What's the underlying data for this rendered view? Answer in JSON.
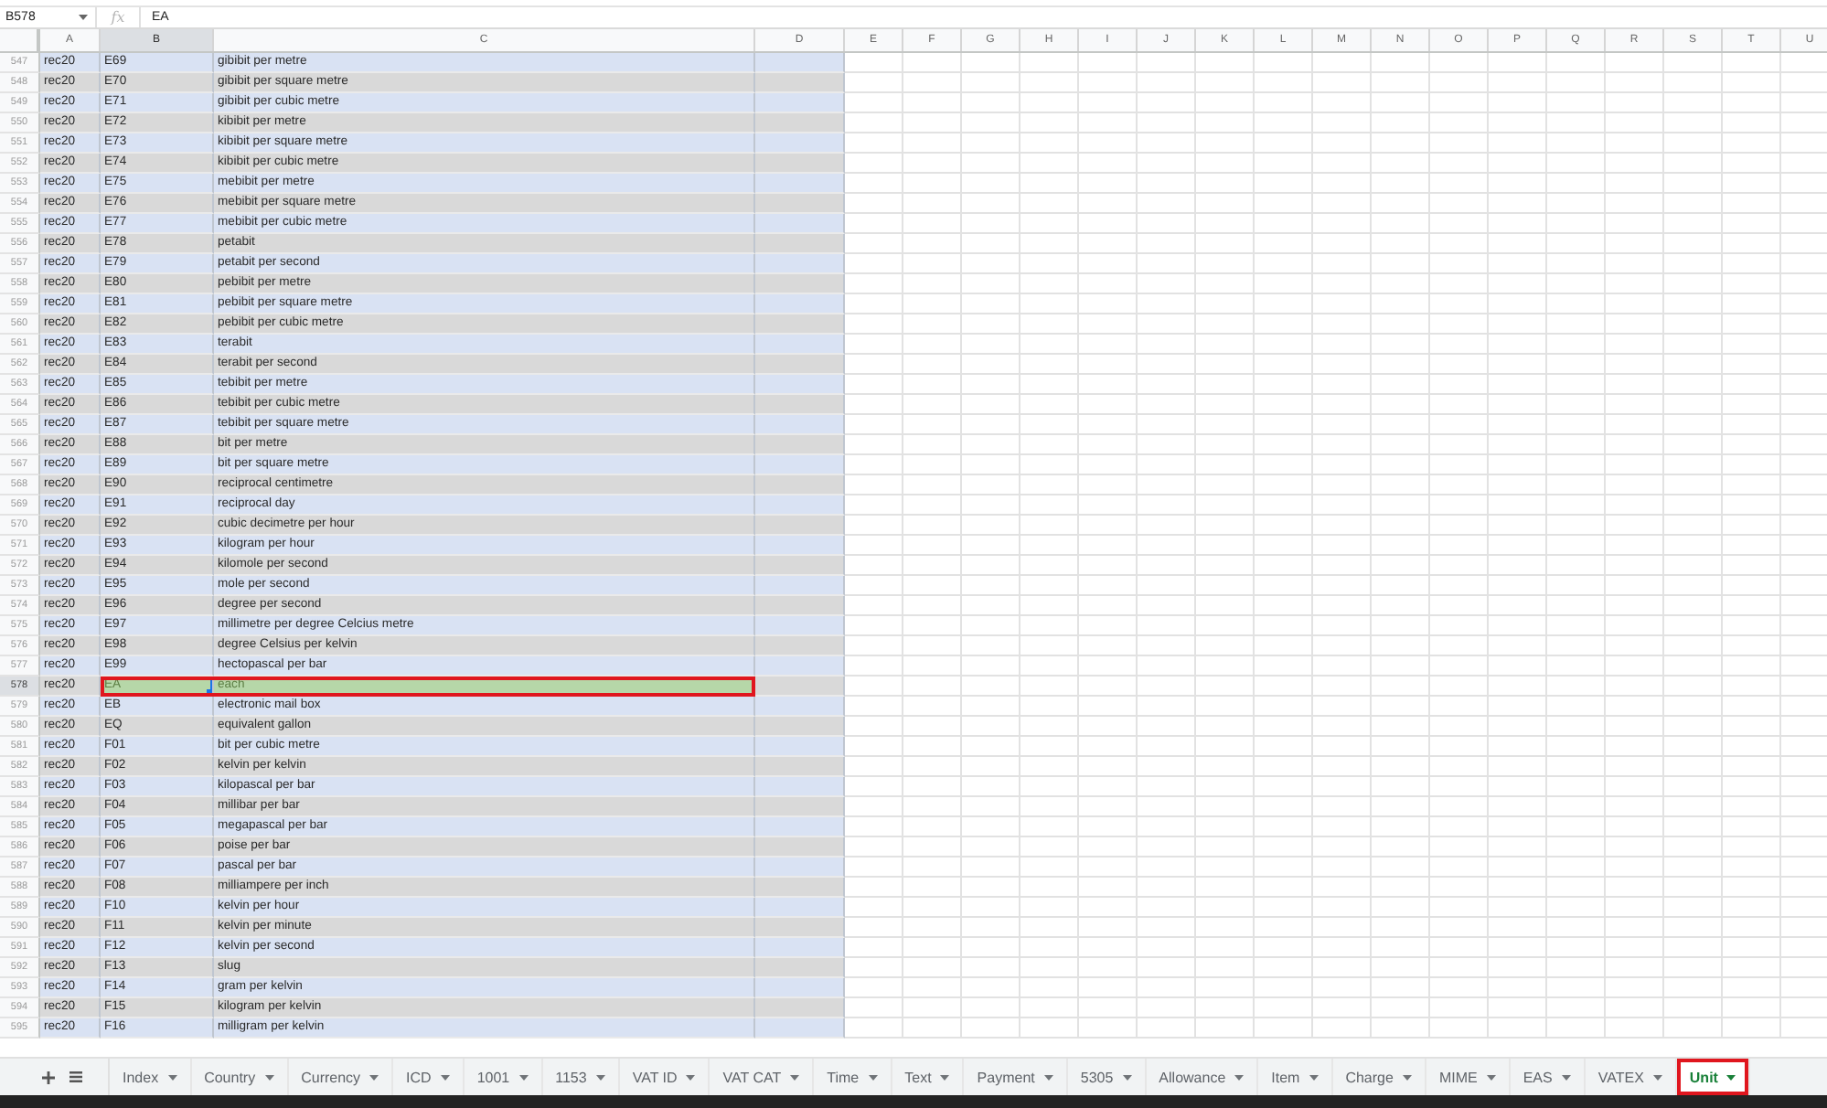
{
  "formula_bar": {
    "name_box": "B578",
    "function_symbol": "fx",
    "value": "EA"
  },
  "columns": [
    {
      "label": "A",
      "selected": false
    },
    {
      "label": "B",
      "selected": true
    },
    {
      "label": "C",
      "selected": false
    },
    {
      "label": "D",
      "selected": false
    },
    {
      "label": "E",
      "selected": false
    },
    {
      "label": "F",
      "selected": false
    },
    {
      "label": "G",
      "selected": false
    },
    {
      "label": "H",
      "selected": false
    },
    {
      "label": "I",
      "selected": false
    },
    {
      "label": "J",
      "selected": false
    },
    {
      "label": "K",
      "selected": false
    },
    {
      "label": "L",
      "selected": false
    },
    {
      "label": "M",
      "selected": false
    },
    {
      "label": "N",
      "selected": false
    },
    {
      "label": "O",
      "selected": false
    },
    {
      "label": "P",
      "selected": false
    },
    {
      "label": "Q",
      "selected": false
    },
    {
      "label": "R",
      "selected": false
    },
    {
      "label": "S",
      "selected": false
    },
    {
      "label": "T",
      "selected": false
    },
    {
      "label": "U",
      "selected": false
    }
  ],
  "rows": [
    {
      "number": "547",
      "outlined": false,
      "cells": [
        {
          "text": "rec20",
          "highlighted": false,
          "selected": false
        },
        {
          "text": "E69",
          "highlighted": false,
          "selected": false
        },
        {
          "text": "gibibit per metre",
          "highlighted": false,
          "selected": false
        }
      ]
    },
    {
      "number": "548",
      "outlined": false,
      "cells": [
        {
          "text": "rec20",
          "highlighted": false,
          "selected": false
        },
        {
          "text": "E70",
          "highlighted": false,
          "selected": false
        },
        {
          "text": "gibibit per square metre",
          "highlighted": false,
          "selected": false
        }
      ]
    },
    {
      "number": "549",
      "outlined": false,
      "cells": [
        {
          "text": "rec20",
          "highlighted": false,
          "selected": false
        },
        {
          "text": "E71",
          "highlighted": false,
          "selected": false
        },
        {
          "text": "gibibit per cubic metre",
          "highlighted": false,
          "selected": false
        }
      ]
    },
    {
      "number": "550",
      "outlined": false,
      "cells": [
        {
          "text": "rec20",
          "highlighted": false,
          "selected": false
        },
        {
          "text": "E72",
          "highlighted": false,
          "selected": false
        },
        {
          "text": "kibibit per metre",
          "highlighted": false,
          "selected": false
        }
      ]
    },
    {
      "number": "551",
      "outlined": false,
      "cells": [
        {
          "text": "rec20",
          "highlighted": false,
          "selected": false
        },
        {
          "text": "E73",
          "highlighted": false,
          "selected": false
        },
        {
          "text": "kibibit per square metre",
          "highlighted": false,
          "selected": false
        }
      ]
    },
    {
      "number": "552",
      "outlined": false,
      "cells": [
        {
          "text": "rec20",
          "highlighted": false,
          "selected": false
        },
        {
          "text": "E74",
          "highlighted": false,
          "selected": false
        },
        {
          "text": "kibibit per cubic metre",
          "highlighted": false,
          "selected": false
        }
      ]
    },
    {
      "number": "553",
      "outlined": false,
      "cells": [
        {
          "text": "rec20",
          "highlighted": false,
          "selected": false
        },
        {
          "text": "E75",
          "highlighted": false,
          "selected": false
        },
        {
          "text": "mebibit per metre",
          "highlighted": false,
          "selected": false
        }
      ]
    },
    {
      "number": "554",
      "outlined": false,
      "cells": [
        {
          "text": "rec20",
          "highlighted": false,
          "selected": false
        },
        {
          "text": "E76",
          "highlighted": false,
          "selected": false
        },
        {
          "text": "mebibit per square metre",
          "highlighted": false,
          "selected": false
        }
      ]
    },
    {
      "number": "555",
      "outlined": false,
      "cells": [
        {
          "text": "rec20",
          "highlighted": false,
          "selected": false
        },
        {
          "text": "E77",
          "highlighted": false,
          "selected": false
        },
        {
          "text": "mebibit per cubic metre",
          "highlighted": false,
          "selected": false
        }
      ]
    },
    {
      "number": "556",
      "outlined": false,
      "cells": [
        {
          "text": "rec20",
          "highlighted": false,
          "selected": false
        },
        {
          "text": "E78",
          "highlighted": false,
          "selected": false
        },
        {
          "text": "petabit",
          "highlighted": false,
          "selected": false
        }
      ]
    },
    {
      "number": "557",
      "outlined": false,
      "cells": [
        {
          "text": "rec20",
          "highlighted": false,
          "selected": false
        },
        {
          "text": "E79",
          "highlighted": false,
          "selected": false
        },
        {
          "text": "petabit per second",
          "highlighted": false,
          "selected": false
        }
      ]
    },
    {
      "number": "558",
      "outlined": false,
      "cells": [
        {
          "text": "rec20",
          "highlighted": false,
          "selected": false
        },
        {
          "text": "E80",
          "highlighted": false,
          "selected": false
        },
        {
          "text": "pebibit per metre",
          "highlighted": false,
          "selected": false
        }
      ]
    },
    {
      "number": "559",
      "outlined": false,
      "cells": [
        {
          "text": "rec20",
          "highlighted": false,
          "selected": false
        },
        {
          "text": "E81",
          "highlighted": false,
          "selected": false
        },
        {
          "text": "pebibit per square metre",
          "highlighted": false,
          "selected": false
        }
      ]
    },
    {
      "number": "560",
      "outlined": false,
      "cells": [
        {
          "text": "rec20",
          "highlighted": false,
          "selected": false
        },
        {
          "text": "E82",
          "highlighted": false,
          "selected": false
        },
        {
          "text": "pebibit per cubic metre",
          "highlighted": false,
          "selected": false
        }
      ]
    },
    {
      "number": "561",
      "outlined": false,
      "cells": [
        {
          "text": "rec20",
          "highlighted": false,
          "selected": false
        },
        {
          "text": "E83",
          "highlighted": false,
          "selected": false
        },
        {
          "text": "terabit",
          "highlighted": false,
          "selected": false
        }
      ]
    },
    {
      "number": "562",
      "outlined": false,
      "cells": [
        {
          "text": "rec20",
          "highlighted": false,
          "selected": false
        },
        {
          "text": "E84",
          "highlighted": false,
          "selected": false
        },
        {
          "text": "terabit per second",
          "highlighted": false,
          "selected": false
        }
      ]
    },
    {
      "number": "563",
      "outlined": false,
      "cells": [
        {
          "text": "rec20",
          "highlighted": false,
          "selected": false
        },
        {
          "text": "E85",
          "highlighted": false,
          "selected": false
        },
        {
          "text": "tebibit per metre",
          "highlighted": false,
          "selected": false
        }
      ]
    },
    {
      "number": "564",
      "outlined": false,
      "cells": [
        {
          "text": "rec20",
          "highlighted": false,
          "selected": false
        },
        {
          "text": "E86",
          "highlighted": false,
          "selected": false
        },
        {
          "text": "tebibit per cubic metre",
          "highlighted": false,
          "selected": false
        }
      ]
    },
    {
      "number": "565",
      "outlined": false,
      "cells": [
        {
          "text": "rec20",
          "highlighted": false,
          "selected": false
        },
        {
          "text": "E87",
          "highlighted": false,
          "selected": false
        },
        {
          "text": "tebibit per square metre",
          "highlighted": false,
          "selected": false
        }
      ]
    },
    {
      "number": "566",
      "outlined": false,
      "cells": [
        {
          "text": "rec20",
          "highlighted": false,
          "selected": false
        },
        {
          "text": "E88",
          "highlighted": false,
          "selected": false
        },
        {
          "text": "bit per metre",
          "highlighted": false,
          "selected": false
        }
      ]
    },
    {
      "number": "567",
      "outlined": false,
      "cells": [
        {
          "text": "rec20",
          "highlighted": false,
          "selected": false
        },
        {
          "text": "E89",
          "highlighted": false,
          "selected": false
        },
        {
          "text": "bit per square metre",
          "highlighted": false,
          "selected": false
        }
      ]
    },
    {
      "number": "568",
      "outlined": false,
      "cells": [
        {
          "text": "rec20",
          "highlighted": false,
          "selected": false
        },
        {
          "text": "E90",
          "highlighted": false,
          "selected": false
        },
        {
          "text": "reciprocal centimetre",
          "highlighted": false,
          "selected": false
        }
      ]
    },
    {
      "number": "569",
      "outlined": false,
      "cells": [
        {
          "text": "rec20",
          "highlighted": false,
          "selected": false
        },
        {
          "text": "E91",
          "highlighted": false,
          "selected": false
        },
        {
          "text": "reciprocal day",
          "highlighted": false,
          "selected": false
        }
      ]
    },
    {
      "number": "570",
      "outlined": false,
      "cells": [
        {
          "text": "rec20",
          "highlighted": false,
          "selected": false
        },
        {
          "text": "E92",
          "highlighted": false,
          "selected": false
        },
        {
          "text": "cubic decimetre per hour",
          "highlighted": false,
          "selected": false
        }
      ]
    },
    {
      "number": "571",
      "outlined": false,
      "cells": [
        {
          "text": "rec20",
          "highlighted": false,
          "selected": false
        },
        {
          "text": "E93",
          "highlighted": false,
          "selected": false
        },
        {
          "text": "kilogram per hour",
          "highlighted": false,
          "selected": false
        }
      ]
    },
    {
      "number": "572",
      "outlined": false,
      "cells": [
        {
          "text": "rec20",
          "highlighted": false,
          "selected": false
        },
        {
          "text": "E94",
          "highlighted": false,
          "selected": false
        },
        {
          "text": "kilomole per second",
          "highlighted": false,
          "selected": false
        }
      ]
    },
    {
      "number": "573",
      "outlined": false,
      "cells": [
        {
          "text": "rec20",
          "highlighted": false,
          "selected": false
        },
        {
          "text": "E95",
          "highlighted": false,
          "selected": false
        },
        {
          "text": "mole per second",
          "highlighted": false,
          "selected": false
        }
      ]
    },
    {
      "number": "574",
      "outlined": false,
      "cells": [
        {
          "text": "rec20",
          "highlighted": false,
          "selected": false
        },
        {
          "text": "E96",
          "highlighted": false,
          "selected": false
        },
        {
          "text": "degree per second",
          "highlighted": false,
          "selected": false
        }
      ]
    },
    {
      "number": "575",
      "outlined": false,
      "cells": [
        {
          "text": "rec20",
          "highlighted": false,
          "selected": false
        },
        {
          "text": "E97",
          "highlighted": false,
          "selected": false
        },
        {
          "text": "millimetre per degree Celcius metre",
          "highlighted": false,
          "selected": false
        }
      ]
    },
    {
      "number": "576",
      "outlined": false,
      "cells": [
        {
          "text": "rec20",
          "highlighted": false,
          "selected": false
        },
        {
          "text": "E98",
          "highlighted": false,
          "selected": false
        },
        {
          "text": "degree Celsius per kelvin",
          "highlighted": false,
          "selected": false
        }
      ]
    },
    {
      "number": "577",
      "outlined": false,
      "cells": [
        {
          "text": "rec20",
          "highlighted": false,
          "selected": false
        },
        {
          "text": "E99",
          "highlighted": false,
          "selected": false
        },
        {
          "text": "hectopascal per bar",
          "highlighted": false,
          "selected": false
        }
      ]
    },
    {
      "number": "578",
      "outlined": true,
      "cells": [
        {
          "text": "rec20",
          "highlighted": false,
          "selected": false
        },
        {
          "text": "EA",
          "highlighted": true,
          "selected": true
        },
        {
          "text": "each",
          "highlighted": true,
          "selected": false
        }
      ]
    },
    {
      "number": "579",
      "outlined": false,
      "cells": [
        {
          "text": "rec20",
          "highlighted": false,
          "selected": false
        },
        {
          "text": "EB",
          "highlighted": false,
          "selected": false
        },
        {
          "text": "electronic mail box",
          "highlighted": false,
          "selected": false
        }
      ]
    },
    {
      "number": "580",
      "outlined": false,
      "cells": [
        {
          "text": "rec20",
          "highlighted": false,
          "selected": false
        },
        {
          "text": "EQ",
          "highlighted": false,
          "selected": false
        },
        {
          "text": "equivalent gallon",
          "highlighted": false,
          "selected": false
        }
      ]
    },
    {
      "number": "581",
      "outlined": false,
      "cells": [
        {
          "text": "rec20",
          "highlighted": false,
          "selected": false
        },
        {
          "text": "F01",
          "highlighted": false,
          "selected": false
        },
        {
          "text": "bit per cubic metre",
          "highlighted": false,
          "selected": false
        }
      ]
    },
    {
      "number": "582",
      "outlined": false,
      "cells": [
        {
          "text": "rec20",
          "highlighted": false,
          "selected": false
        },
        {
          "text": "F02",
          "highlighted": false,
          "selected": false
        },
        {
          "text": "kelvin per kelvin",
          "highlighted": false,
          "selected": false
        }
      ]
    },
    {
      "number": "583",
      "outlined": false,
      "cells": [
        {
          "text": "rec20",
          "highlighted": false,
          "selected": false
        },
        {
          "text": "F03",
          "highlighted": false,
          "selected": false
        },
        {
          "text": "kilopascal per bar",
          "highlighted": false,
          "selected": false
        }
      ]
    },
    {
      "number": "584",
      "outlined": false,
      "cells": [
        {
          "text": "rec20",
          "highlighted": false,
          "selected": false
        },
        {
          "text": "F04",
          "highlighted": false,
          "selected": false
        },
        {
          "text": "millibar per bar",
          "highlighted": false,
          "selected": false
        }
      ]
    },
    {
      "number": "585",
      "outlined": false,
      "cells": [
        {
          "text": "rec20",
          "highlighted": false,
          "selected": false
        },
        {
          "text": "F05",
          "highlighted": false,
          "selected": false
        },
        {
          "text": "megapascal per bar",
          "highlighted": false,
          "selected": false
        }
      ]
    },
    {
      "number": "586",
      "outlined": false,
      "cells": [
        {
          "text": "rec20",
          "highlighted": false,
          "selected": false
        },
        {
          "text": "F06",
          "highlighted": false,
          "selected": false
        },
        {
          "text": "poise per bar",
          "highlighted": false,
          "selected": false
        }
      ]
    },
    {
      "number": "587",
      "outlined": false,
      "cells": [
        {
          "text": "rec20",
          "highlighted": false,
          "selected": false
        },
        {
          "text": "F07",
          "highlighted": false,
          "selected": false
        },
        {
          "text": "pascal per bar",
          "highlighted": false,
          "selected": false
        }
      ]
    },
    {
      "number": "588",
      "outlined": false,
      "cells": [
        {
          "text": "rec20",
          "highlighted": false,
          "selected": false
        },
        {
          "text": "F08",
          "highlighted": false,
          "selected": false
        },
        {
          "text": "milliampere per inch",
          "highlighted": false,
          "selected": false
        }
      ]
    },
    {
      "number": "589",
      "outlined": false,
      "cells": [
        {
          "text": "rec20",
          "highlighted": false,
          "selected": false
        },
        {
          "text": "F10",
          "highlighted": false,
          "selected": false
        },
        {
          "text": "kelvin per hour",
          "highlighted": false,
          "selected": false
        }
      ]
    },
    {
      "number": "590",
      "outlined": false,
      "cells": [
        {
          "text": "rec20",
          "highlighted": false,
          "selected": false
        },
        {
          "text": "F11",
          "highlighted": false,
          "selected": false
        },
        {
          "text": "kelvin per minute",
          "highlighted": false,
          "selected": false
        }
      ]
    },
    {
      "number": "591",
      "outlined": false,
      "cells": [
        {
          "text": "rec20",
          "highlighted": false,
          "selected": false
        },
        {
          "text": "F12",
          "highlighted": false,
          "selected": false
        },
        {
          "text": "kelvin per second",
          "highlighted": false,
          "selected": false
        }
      ]
    },
    {
      "number": "592",
      "outlined": false,
      "cells": [
        {
          "text": "rec20",
          "highlighted": false,
          "selected": false
        },
        {
          "text": "F13",
          "highlighted": false,
          "selected": false
        },
        {
          "text": "slug",
          "highlighted": false,
          "selected": false
        }
      ]
    },
    {
      "number": "593",
      "outlined": false,
      "cells": [
        {
          "text": "rec20",
          "highlighted": false,
          "selected": false
        },
        {
          "text": "F14",
          "highlighted": false,
          "selected": false
        },
        {
          "text": "gram per kelvin",
          "highlighted": false,
          "selected": false
        }
      ]
    },
    {
      "number": "594",
      "outlined": false,
      "cells": [
        {
          "text": "rec20",
          "highlighted": false,
          "selected": false
        },
        {
          "text": "F15",
          "highlighted": false,
          "selected": false
        },
        {
          "text": "kilogram per kelvin",
          "highlighted": false,
          "selected": false
        }
      ]
    },
    {
      "number": "595",
      "outlined": false,
      "cells": [
        {
          "text": "rec20",
          "highlighted": false,
          "selected": false
        },
        {
          "text": "F16",
          "highlighted": false,
          "selected": false
        },
        {
          "text": "milligram per kelvin",
          "highlighted": false,
          "selected": false
        }
      ]
    }
  ],
  "sheet_tabs": [
    {
      "label": "Index",
      "selected": false,
      "outlined": false
    },
    {
      "label": "Country",
      "selected": false,
      "outlined": false
    },
    {
      "label": "Currency",
      "selected": false,
      "outlined": false
    },
    {
      "label": "ICD",
      "selected": false,
      "outlined": false
    },
    {
      "label": "1001",
      "selected": false,
      "outlined": false
    },
    {
      "label": "1153",
      "selected": false,
      "outlined": false
    },
    {
      "label": "VAT ID",
      "selected": false,
      "outlined": false
    },
    {
      "label": "VAT CAT",
      "selected": false,
      "outlined": false
    },
    {
      "label": "Time",
      "selected": false,
      "outlined": false
    },
    {
      "label": "Text",
      "selected": false,
      "outlined": false
    },
    {
      "label": "Payment",
      "selected": false,
      "outlined": false
    },
    {
      "label": "5305",
      "selected": false,
      "outlined": false
    },
    {
      "label": "Allowance",
      "selected": false,
      "outlined": false
    },
    {
      "label": "Item",
      "selected": false,
      "outlined": false
    },
    {
      "label": "Charge",
      "selected": false,
      "outlined": false
    },
    {
      "label": "MIME",
      "selected": false,
      "outlined": false
    },
    {
      "label": "EAS",
      "selected": false,
      "outlined": false
    },
    {
      "label": "VATEX",
      "selected": false,
      "outlined": false
    },
    {
      "label": "Unit",
      "selected": true,
      "outlined": true
    }
  ]
}
